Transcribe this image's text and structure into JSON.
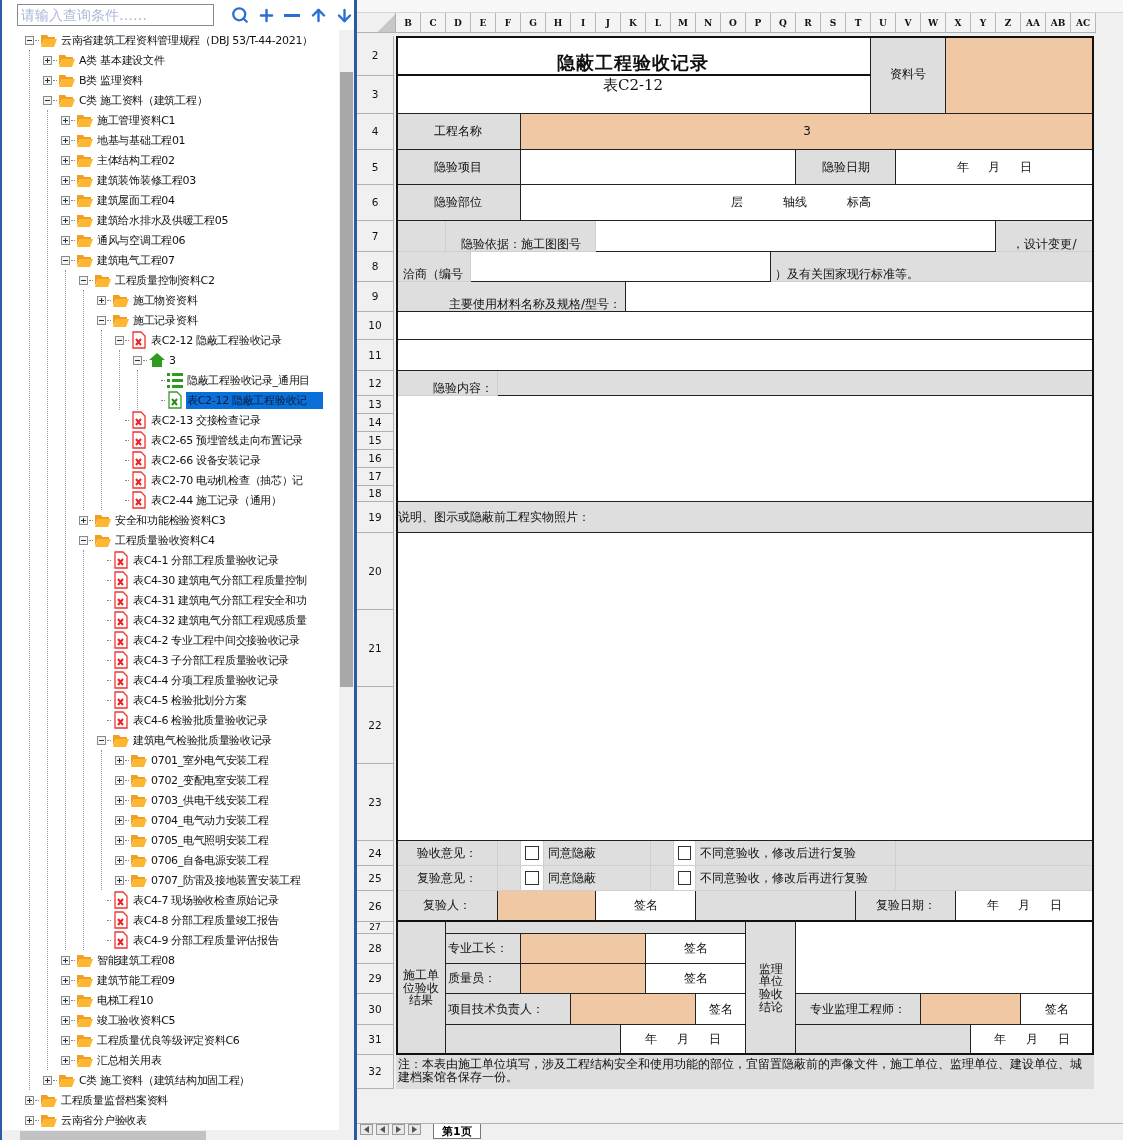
{
  "search": {
    "placeholder": "请输入查询条件……"
  },
  "tree": [
    {
      "label": "云南省建筑工程资料管理规程（DBJ 53/T-44-2021）",
      "kind": "folder",
      "expanded": true,
      "selected": false,
      "children": [
        {
          "label": "A类 基本建设文件",
          "kind": "folder",
          "expanded": false,
          "selected": false
        },
        {
          "label": "B类 监理资料",
          "kind": "folder",
          "expanded": false,
          "selected": false
        },
        {
          "label": "C类 施工资料（建筑工程）",
          "kind": "folder",
          "expanded": true,
          "selected": false,
          "children": [
            {
              "label": "施工管理资料C1",
              "kind": "folder",
              "expanded": false,
              "selected": false
            },
            {
              "label": "地基与基础工程01",
              "kind": "folder",
              "expanded": false,
              "selected": false
            },
            {
              "label": "主体结构工程02",
              "kind": "folder",
              "expanded": false,
              "selected": false
            },
            {
              "label": "建筑装饰装修工程03",
              "kind": "folder",
              "expanded": false,
              "selected": false
            },
            {
              "label": "建筑屋面工程04",
              "kind": "folder",
              "expanded": false,
              "selected": false
            },
            {
              "label": "建筑给水排水及供暖工程05",
              "kind": "folder",
              "expanded": false,
              "selected": false
            },
            {
              "label": "通风与空调工程06",
              "kind": "folder",
              "expanded": false,
              "selected": false
            },
            {
              "label": "建筑电气工程07",
              "kind": "folder",
              "expanded": true,
              "selected": false,
              "children": [
                {
                  "label": "工程质量控制资料C2",
                  "kind": "folder",
                  "expanded": true,
                  "selected": false,
                  "children": [
                    {
                      "label": "施工物资资料",
                      "kind": "folder",
                      "expanded": false,
                      "selected": false
                    },
                    {
                      "label": "施工记录资料",
                      "kind": "folder",
                      "expanded": true,
                      "selected": false,
                      "children": [
                        {
                          "label": "表C2-12 隐蔽工程验收记录",
                          "kind": "form",
                          "expanded": true,
                          "selected": false,
                          "children": [
                            {
                              "label": "3",
                              "kind": "project",
                              "expanded": true,
                              "selected": false,
                              "children": [
                                {
                                  "label": "隐蔽工程验收记录_通用目",
                                  "kind": "list",
                                  "selected": false
                                },
                                {
                                  "label": "表C2-12 隐蔽工程验收记",
                                  "kind": "sheet",
                                  "selected": true
                                }
                              ]
                            }
                          ]
                        },
                        {
                          "label": "表C2-13 交接检查记录",
                          "kind": "form",
                          "selected": false
                        },
                        {
                          "label": "表C2-65 预埋管线走向布置记录",
                          "kind": "form",
                          "selected": false
                        },
                        {
                          "label": "表C2-66 设备安装记录",
                          "kind": "form",
                          "selected": false
                        },
                        {
                          "label": "表C2-70 电动机检查（抽芯）记",
                          "kind": "form",
                          "selected": false
                        },
                        {
                          "label": "表C2-44 施工记录（通用）",
                          "kind": "form",
                          "selected": false
                        }
                      ]
                    }
                  ]
                },
                {
                  "label": "安全和功能检验资料C3",
                  "kind": "folder",
                  "expanded": false,
                  "selected": false
                },
                {
                  "label": "工程质量验收资料C4",
                  "kind": "folder",
                  "expanded": true,
                  "selected": false,
                  "children": [
                    {
                      "label": "表C4-1 分部工程质量验收记录",
                      "kind": "form",
                      "selected": false
                    },
                    {
                      "label": "表C4-30 建筑电气分部工程质量控制",
                      "kind": "form",
                      "selected": false
                    },
                    {
                      "label": "表C4-31 建筑电气分部工程安全和功",
                      "kind": "form",
                      "selected": false
                    },
                    {
                      "label": "表C4-32 建筑电气分部工程观感质量",
                      "kind": "form",
                      "selected": false
                    },
                    {
                      "label": "表C4-2 专业工程中间交接验收记录",
                      "kind": "form",
                      "selected": false
                    },
                    {
                      "label": "表C4-3 子分部工程质量验收记录",
                      "kind": "form",
                      "selected": false
                    },
                    {
                      "label": "表C4-4 分项工程质量验收记录",
                      "kind": "form",
                      "selected": false
                    },
                    {
                      "label": "表C4-5 检验批划分方案",
                      "kind": "form",
                      "selected": false
                    },
                    {
                      "label": "表C4-6 检验批质量验收记录",
                      "kind": "form",
                      "selected": false
                    },
                    {
                      "label": "建筑电气检验批质量验收记录",
                      "kind": "folder",
                      "expanded": true,
                      "selected": false,
                      "children": [
                        {
                          "label": "0701_室外电气安装工程",
                          "kind": "folder",
                          "expanded": false,
                          "selected": false
                        },
                        {
                          "label": "0702_变配电室安装工程",
                          "kind": "folder",
                          "expanded": false,
                          "selected": false
                        },
                        {
                          "label": "0703_供电干线安装工程",
                          "kind": "folder",
                          "expanded": false,
                          "selected": false
                        },
                        {
                          "label": "0704_电气动力安装工程",
                          "kind": "folder",
                          "expanded": false,
                          "selected": false
                        },
                        {
                          "label": "0705_电气照明安装工程",
                          "kind": "folder",
                          "expanded": false,
                          "selected": false
                        },
                        {
                          "label": "0706_自备电源安装工程",
                          "kind": "folder",
                          "expanded": false,
                          "selected": false
                        },
                        {
                          "label": "0707_防雷及接地装置安装工程",
                          "kind": "folder",
                          "expanded": false,
                          "selected": false
                        }
                      ]
                    },
                    {
                      "label": "表C4-7 现场验收检查原始记录",
                      "kind": "form",
                      "selected": false
                    },
                    {
                      "label": "表C4-8 分部工程质量竣工报告",
                      "kind": "form",
                      "selected": false
                    },
                    {
                      "label": "表C4-9 分部工程质量评估报告",
                      "kind": "form",
                      "selected": false
                    }
                  ]
                }
              ]
            },
            {
              "label": "智能建筑工程08",
              "kind": "folder",
              "expanded": false,
              "selected": false
            },
            {
              "label": "建筑节能工程09",
              "kind": "folder",
              "expanded": false,
              "selected": false
            },
            {
              "label": "电梯工程10",
              "kind": "folder",
              "expanded": false,
              "selected": false
            },
            {
              "label": "竣工验收资料C5",
              "kind": "folder",
              "expanded": false,
              "selected": false
            },
            {
              "label": "工程质量优良等级评定资料C6",
              "kind": "folder",
              "expanded": false,
              "selected": false
            },
            {
              "label": "汇总相关用表",
              "kind": "folder",
              "expanded": false,
              "selected": false
            }
          ]
        },
        {
          "label": "C类 施工资料（建筑结构加固工程）",
          "kind": "folder",
          "expanded": false,
          "selected": false
        }
      ]
    },
    {
      "label": "工程质量监督档案资料",
      "kind": "folder",
      "expanded": false,
      "selected": false
    },
    {
      "label": "云南省分户验收表",
      "kind": "folder",
      "expanded": false,
      "selected": false
    }
  ],
  "sheet": {
    "column_headers": [
      "B",
      "C",
      "D",
      "E",
      "F",
      "G",
      "H",
      "I",
      "J",
      "K",
      "L",
      "M",
      "N",
      "O",
      "P",
      "Q",
      "R",
      "S",
      "T",
      "U",
      "V",
      "W",
      "X",
      "Y",
      "Z",
      "AA",
      "AB",
      "AC"
    ],
    "row_numbers": [
      "2",
      "3",
      "4",
      "5",
      "6",
      "7",
      "8",
      "9",
      "10",
      "11",
      "12",
      "13",
      "14",
      "15",
      "16",
      "17",
      "18",
      "19",
      "20",
      "21",
      "22",
      "23",
      "24",
      "25",
      "26",
      "27",
      "28",
      "29",
      "30",
      "31",
      "32"
    ],
    "form": {
      "title": "隐蔽工程验收记录",
      "subtitle": "表C2-12",
      "doc_no_label": "资料号",
      "project_name_label": "工程名称",
      "project_name": "3",
      "item_label": "隐验项目",
      "date_label": "隐验日期",
      "date": "年 月 日",
      "location_label": "隐验部位",
      "location_text": "层 轴线 标高",
      "basis_label": "隐验依据：施工图图号",
      "basis_suffix": "，设计变更/",
      "change_prefix": "洽商（编号",
      "change_suffix": "）及有关国家现行标准等。",
      "materials_label": "主要使用材料名称及规格/型号：",
      "content_label": "隐验内容：",
      "photos_label": "说明、图示或隐蔽前工程实物照片：",
      "opinions": [
        {
          "label": "验收意见：",
          "options": [
            {
              "label": "同意隐蔽",
              "checked": false
            },
            {
              "label": "不同意验收，修改后进行复验",
              "checked": false
            }
          ]
        },
        {
          "label": "复验意见：",
          "options": [
            {
              "label": "同意隐蔽",
              "checked": false
            },
            {
              "label": "不同意验收，修改后再进行复验",
              "checked": false
            }
          ]
        }
      ],
      "recheck": {
        "person_label": "复验人：",
        "sign": "签名",
        "date_label": "复验日期：",
        "date": "年 月 日"
      },
      "contractor": {
        "title": "施工单位验收结果",
        "signers": [
          {
            "label": "专业工长：",
            "sign": "签名"
          },
          {
            "label": "质量员：",
            "sign": "签名"
          },
          {
            "label": "项目技术负责人：",
            "sign": "签名"
          }
        ],
        "date": "年 月 日"
      },
      "supervisor": {
        "title": "监理单位验收结论",
        "signer": {
          "label": "专业监理工程师：",
          "sign": "签名"
        },
        "date": "年 月 日"
      },
      "note": "注：本表由施工单位填写，涉及工程结构安全和使用功能的部位，宜留置隐蔽前的声像文件，施工单位、监理单位、建设单位、城建档案馆各保存一份。"
    },
    "tabs": [
      {
        "label": "第1页",
        "selected": true
      }
    ]
  }
}
